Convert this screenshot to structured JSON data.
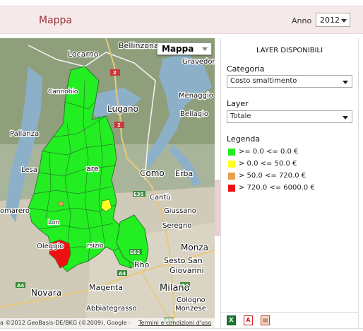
{
  "header": {
    "title": "Mappa",
    "year_label": "Anno",
    "year_value": "2012"
  },
  "map": {
    "type_selector": "Mappa",
    "places": {
      "bellinzona": "Bellinzona",
      "locarno": "Locarno",
      "gravedona": "Gravedona",
      "cannobio": "Cannobio",
      "menaggio": "Menaggio",
      "lugano": "Lugano",
      "bellagio": "Bellagio",
      "pallanza": "Pallanza",
      "lesa": "Lesa",
      "como": "Como",
      "erba": "Erba",
      "cantu": "Cantù",
      "omarero": "omarero",
      "giussano": "Giussano",
      "seregno": "Seregno",
      "oleggio": "Oleggio",
      "monza": "Monza",
      "rho": "Rho",
      "sesto": "Sesto San",
      "giovanni": "Giovanni",
      "novara": "Novara",
      "magenta": "Magenta",
      "milano": "Milano",
      "cologno": "Cologno",
      "monzese": "Monzese",
      "abbiategrasso": "Abbiategrasso",
      "lonate": "Lon",
      "arsizio": "rsizio",
      "varese": "are"
    },
    "road_shields": [
      "2",
      "2",
      "E35",
      "E62",
      "A4",
      "A4",
      "A4",
      "A1"
    ],
    "attribution": "a ©2012 GeoBasis-DE/BKG (©2009), Google -",
    "terms": "Termini e condizioni d'uso"
  },
  "panel": {
    "title": "LAYER DISPONIBILI",
    "category_label": "Categoria",
    "category_value": "Costo smaltimento",
    "layer_label": "Layer",
    "layer_value": "Totale",
    "legend_label": "Legenda",
    "legend": [
      {
        "color": "#22ee22",
        "text": ">= 0.0 <= 0.0 €"
      },
      {
        "color": "#ffff22",
        "text": "> 0.0 <= 50.0 €"
      },
      {
        "color": "#e8a050",
        "text": "> 50.0 <= 720.0 €"
      },
      {
        "color": "#ee1111",
        "text": "> 720.0 <= 6000.0 €"
      }
    ],
    "footer_buttons": [
      "excel-export",
      "pdf-export",
      "print"
    ]
  }
}
